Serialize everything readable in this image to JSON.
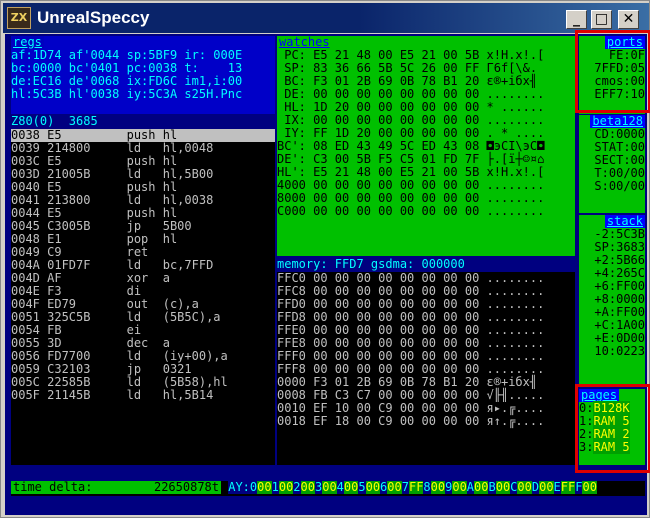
{
  "window": {
    "title": "UnrealSpeccy",
    "icon_text": "ZX"
  },
  "regs": {
    "header": "regs",
    "lines": [
      "af:1D74 af'0044 sp:5BF9 ir: 000E",
      "bc:0000 bc'0401 pc:0038 t:    13",
      "de:EC16 de'0068 ix:FD6C im1,i:00",
      "hl:5C3B hl'0038 iy:5C3A s25H.Pnc"
    ]
  },
  "z80_header": "Z80(0)  3685",
  "disasm": [
    "0038 E5         push hl",
    "0039 214800     ld   hl,0048",
    "003C E5         push hl",
    "003D 21005B     ld   hl,5B00",
    "0040 E5         push hl",
    "0041 213800     ld   hl,0038",
    "0044 E5         push hl",
    "0045 C3005B     jp   5B00",
    "0048 E1         pop  hl",
    "0049 C9         ret",
    "004A 01FD7F     ld   bc,7FFD",
    "004D AF         xor  a",
    "004E F3         di",
    "004F ED79       out  (c),a",
    "0051 325C5B     ld   (5B5C),a",
    "0054 FB         ei",
    "0055 3D         dec  a",
    "0056 FD7700     ld   (iy+00),a",
    "0059 C32103     jp   0321",
    "005C 22585B     ld   (5B58),hl",
    "005F 21145B     ld   hl,5B14"
  ],
  "watches": {
    "header": "watches",
    "lines": [
      " PC: E5 21 48 00 E5 21 00 5B x!H.x!.[",
      " SP: 83 36 66 5B 5C 26 00 FF Г6f[\\&.",
      " BC: F3 01 2B 69 0B 78 B1 20 ε®+iбx╢ ",
      " DE: 00 00 00 00 00 00 00 00 ........",
      " HL: 1D 20 00 00 00 00 00 00 * ......",
      " IX: 00 00 00 00 00 00 00 00 ........",
      " IY: FF 1D 20 00 00 00 00 00 . * ....",
      "BC': 08 ED 43 49 5C ED 43 08 ◘эCI\\эC◘",
      "DE': C3 00 5B F5 C5 01 FD 7F ├.[ї┼☺¤⌂",
      "HL': E5 21 48 00 E5 21 00 5B x!H.x!.[",
      "4000 00 00 00 00 00 00 00 00 ........",
      "8000 00 00 00 00 00 00 00 00 ........",
      "C000 00 00 00 00 00 00 00 00 ........"
    ]
  },
  "memory_header": "memory: FFD7 gsdma: 000000",
  "memory": [
    "FFC0 00 00 00 00 00 00 00 00 ........",
    "FFC8 00 00 00 00 00 00 00 00 ........",
    "FFD0 00 00 00 00 00 00 00 00 ........",
    "FFD8 00 00 00 00 00 00 00 00 ........",
    "FFE0 00 00 00 00 00 00 00 00 ........",
    "FFE8 00 00 00 00 00 00 00 00 ........",
    "FFF0 00 00 00 00 00 00 00 00 ........",
    "FFF8 00 00 00 00 00 00 00 00 ........",
    "0000 F3 01 2B 69 0B 78 B1 20 ε®+iбx╢ ",
    "0008 FB C3 C7 00 00 00 00 00 √╟╢.....",
    "0010 EF 10 00 C9 00 00 00 00 я▸.╔....",
    "0018 EF 18 00 C9 00 00 00 00 я↑.╔...."
  ],
  "ports": {
    "header": "ports",
    "lines": [
      "FE:0F",
      "7FFD:05",
      "cmos:00",
      "EFF7:10"
    ]
  },
  "beta": {
    "header": "beta128",
    "lines": [
      "CD:0000",
      "STAT:00",
      "SECT:00",
      "T:00/00",
      "S:00/00"
    ]
  },
  "stack": {
    "header": "stack",
    "lines": [
      "-2:5C3B",
      "SP:3683",
      "+2:5B66",
      "+4:265C",
      "+6:FF00",
      "+8:0000",
      "+A:FF00",
      "+C:1A00",
      "+E:0D00",
      "10:0223"
    ]
  },
  "pages": {
    "header": "pages",
    "items": [
      {
        "k": "0:",
        "v": "B128K"
      },
      {
        "k": "1:",
        "v": "RAM 5"
      },
      {
        "k": "2:",
        "v": "RAM 2"
      },
      {
        "k": "3:",
        "v": "RAM 5"
      }
    ]
  },
  "bottom": {
    "time_label": "time delta:",
    "time_value": "22650878t",
    "ay_label": "AY:",
    "ay_regs": [
      {
        "k": "0",
        "v": "00"
      },
      {
        "k": "1",
        "v": "00"
      },
      {
        "k": "2",
        "v": "00"
      },
      {
        "k": "3",
        "v": "00"
      },
      {
        "k": "4",
        "v": "00"
      },
      {
        "k": "5",
        "v": "00"
      },
      {
        "k": "6",
        "v": "00"
      },
      {
        "k": "7",
        "v": "FF"
      },
      {
        "k": "8",
        "v": "00"
      },
      {
        "k": "9",
        "v": "00"
      },
      {
        "k": "A",
        "v": "00"
      },
      {
        "k": "B",
        "v": "00"
      },
      {
        "k": "C",
        "v": "00"
      },
      {
        "k": "D",
        "v": "00"
      },
      {
        "k": "E",
        "v": "FF"
      },
      {
        "k": "F",
        "v": "00"
      }
    ]
  }
}
